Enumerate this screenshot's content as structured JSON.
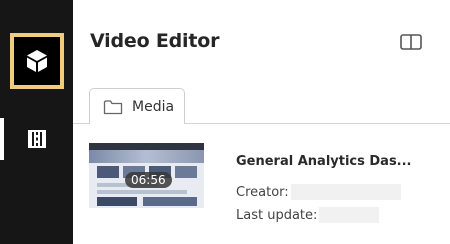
{
  "header": {
    "title": "Video Editor"
  },
  "tabs": [
    {
      "label": "Media"
    }
  ],
  "media": [
    {
      "title": "General Analytics Das...",
      "duration": "06:56",
      "creator_label": "Creator:",
      "updated_label": "Last update:"
    }
  ],
  "icons": {
    "logo": "cube-icon",
    "nav": "film-strip-icon",
    "panel": "panel-toggle-icon",
    "tab": "folder-icon"
  },
  "colors": {
    "accent": "#f1cc7c",
    "sidebar": "#161616"
  }
}
